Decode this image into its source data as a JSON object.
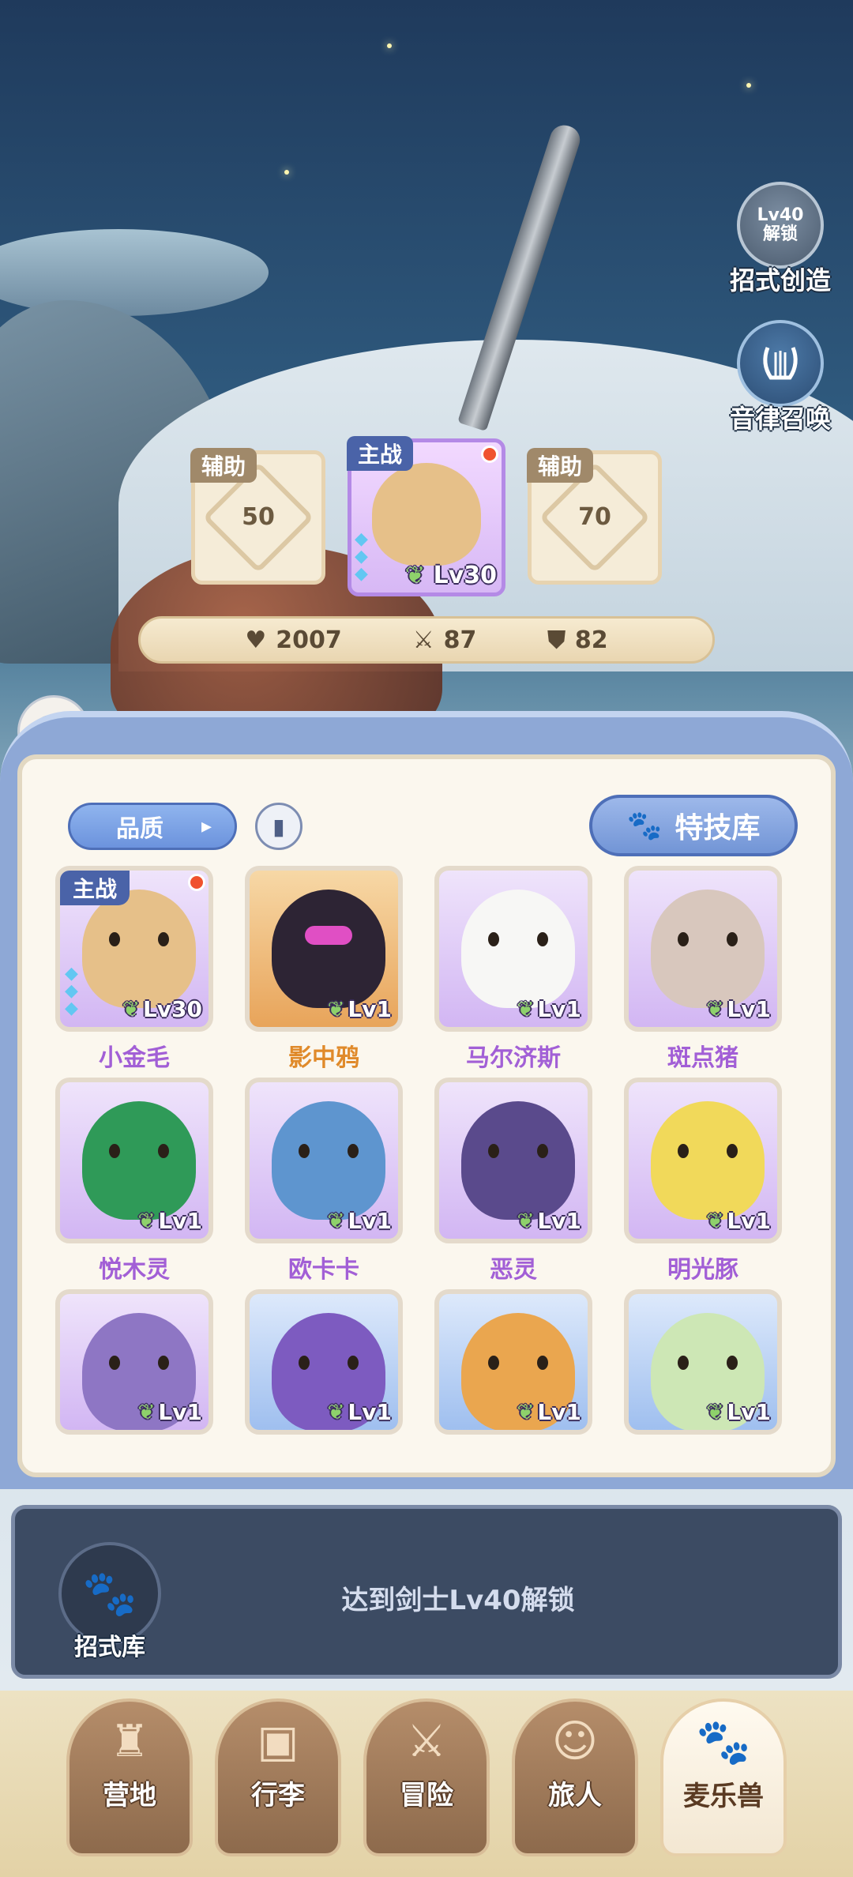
{
  "side_buttons": {
    "move_create": {
      "lock_level": "Lv40",
      "lock_text": "解锁",
      "label": "招式创造"
    },
    "rhythm_summon": {
      "label": "音律召唤"
    }
  },
  "team": {
    "left": {
      "tag": "辅助",
      "unlock_level": "50"
    },
    "main": {
      "tag": "主战",
      "level": "Lv30"
    },
    "right": {
      "tag": "辅助",
      "unlock_level": "70"
    }
  },
  "stats": {
    "hp": "2007",
    "attack": "87",
    "defense": "82"
  },
  "panel": {
    "filter_label": "品质",
    "skill_library_label": "特技库",
    "pets": [
      {
        "name": "小金毛",
        "level": "Lv30",
        "rarity": "purple",
        "tag": "主战"
      },
      {
        "name": "影中鸦",
        "level": "Lv1",
        "rarity": "orange"
      },
      {
        "name": "马尔济斯",
        "level": "Lv1",
        "rarity": "purple"
      },
      {
        "name": "斑点猪",
        "level": "Lv1",
        "rarity": "purple"
      },
      {
        "name": "悦木灵",
        "level": "Lv1",
        "rarity": "purple"
      },
      {
        "name": "欧卡卡",
        "level": "Lv1",
        "rarity": "purple"
      },
      {
        "name": "恶灵",
        "level": "Lv1",
        "rarity": "purple"
      },
      {
        "name": "明光豚",
        "level": "Lv1",
        "rarity": "purple"
      },
      {
        "name": "",
        "level": "Lv1",
        "rarity": "purple"
      },
      {
        "name": "",
        "level": "Lv1",
        "rarity": "blue"
      },
      {
        "name": "",
        "level": "Lv1",
        "rarity": "blue"
      },
      {
        "name": "",
        "level": "Lv1",
        "rarity": "blue"
      }
    ]
  },
  "lock_bar": {
    "message": "达到剑士Lv40解锁",
    "icon_label": "招式库"
  },
  "nav": {
    "tabs": [
      {
        "label": "营地",
        "icon": "castle-icon"
      },
      {
        "label": "行李",
        "icon": "backpack-icon"
      },
      {
        "label": "冒险",
        "icon": "crossed-swords-icon"
      },
      {
        "label": "旅人",
        "icon": "traveler-icon"
      },
      {
        "label": "麦乐兽",
        "icon": "pet-icon",
        "active": true
      }
    ]
  },
  "colors": {
    "accent_blue": "#6c93dd",
    "panel_bg": "#fbf7ee",
    "purple_rarity": "#a25fd6",
    "orange_rarity": "#e08a2a"
  }
}
